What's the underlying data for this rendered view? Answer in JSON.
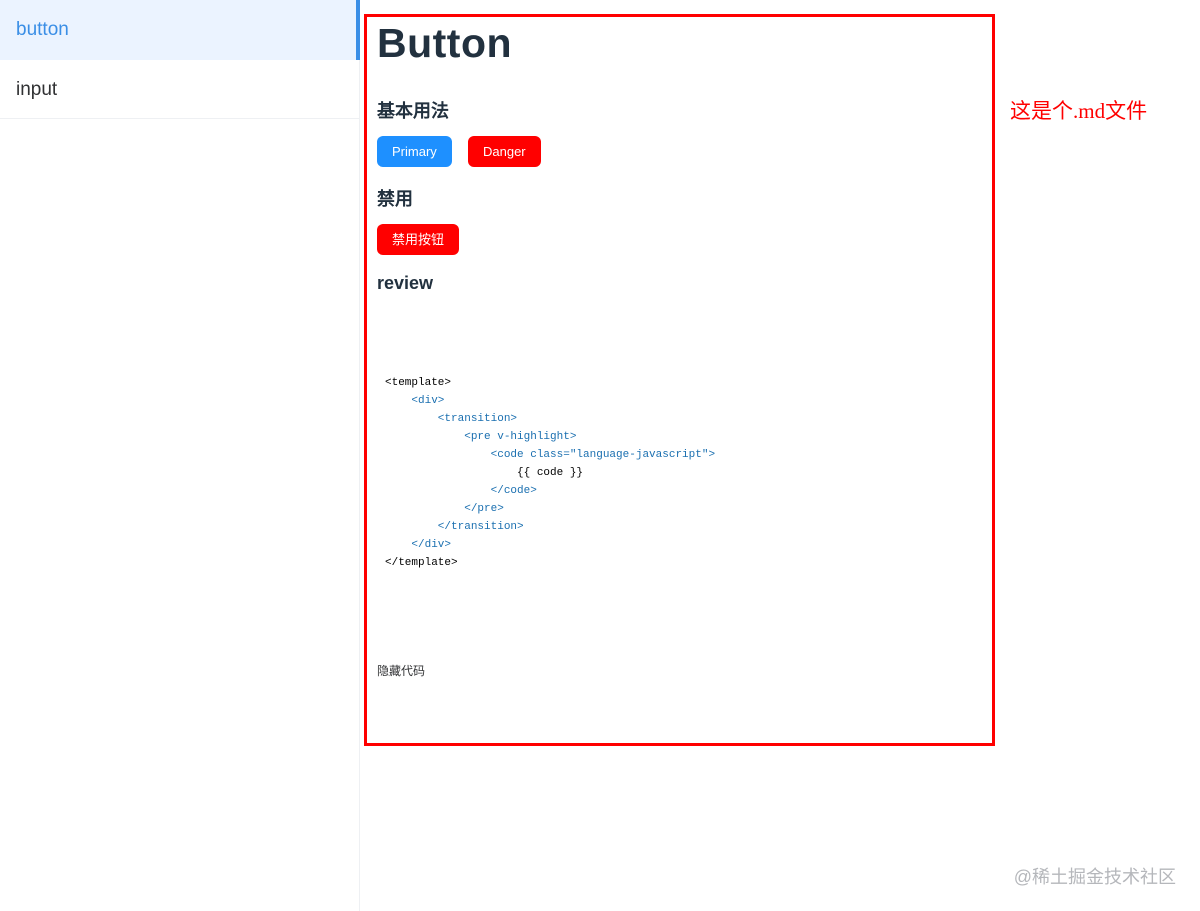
{
  "sidebar": {
    "items": [
      {
        "label": "button",
        "active": true
      },
      {
        "label": "input",
        "active": false
      }
    ],
    "accent_color": "#3a8ee6"
  },
  "doc": {
    "title": "Button",
    "sections": {
      "basic": "基本用法",
      "disabled": "禁用",
      "review": "review"
    },
    "buttons": {
      "primary": "Primary",
      "danger": "Danger",
      "disabled": "禁用按钮"
    },
    "code_lines": [
      "<template>",
      "    <div>",
      "        <transition>",
      "            <pre v-highlight>",
      "                <code class=\"language-javascript\">",
      "                    {{ code }}",
      "                </code>",
      "            </pre>",
      "        </transition>",
      "    </div>",
      "</template>"
    ],
    "toggle_code": "隐藏代码",
    "frame_color": "#ff0000",
    "primary_color": "#1e90ff",
    "danger_color": "#ff0000"
  },
  "annotation": "这是个.md文件",
  "watermark": "@稀土掘金技术社区"
}
